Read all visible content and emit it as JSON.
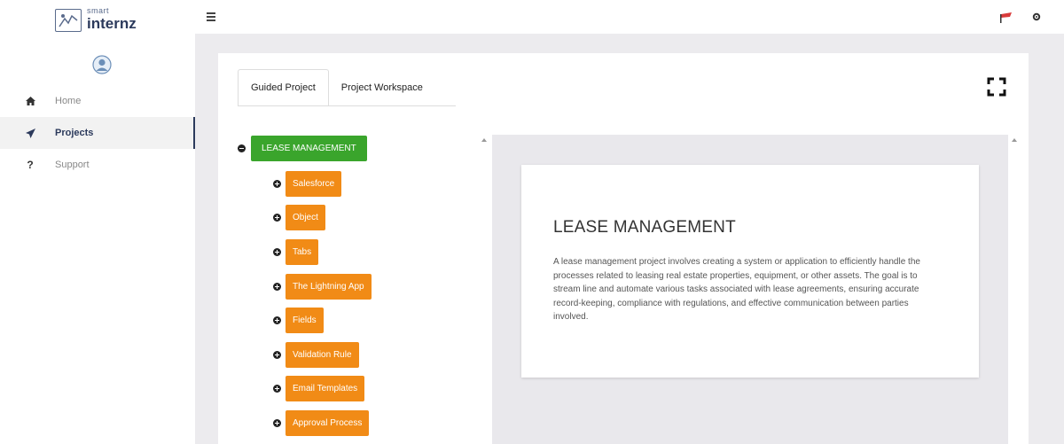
{
  "brand": {
    "line1": "smart",
    "line2": "internz"
  },
  "sidebar": {
    "items": [
      {
        "label": "Home",
        "icon": "home-icon",
        "active": false
      },
      {
        "label": "Projects",
        "icon": "paper-plane-icon",
        "active": true
      },
      {
        "label": "Support",
        "icon": "question-icon",
        "active": false
      }
    ]
  },
  "header": {
    "menu_icon": "hamburger-icon",
    "flag_icon": "flag-icon",
    "settings_icon": "gear-icon"
  },
  "tabs": [
    {
      "label": "Guided Project",
      "active": true
    },
    {
      "label": "Project Workspace",
      "active": false
    }
  ],
  "tree": {
    "root": "LEASE MANAGEMENT",
    "children": [
      "Salesforce",
      "Object",
      "Tabs",
      "The Lightning App",
      "Fields",
      "Validation Rule",
      "Email Templates",
      "Approval Process"
    ]
  },
  "detail": {
    "title": "LEASE MANAGEMENT",
    "description": "A lease management project involves creating a system or application to efficiently handle the processes related to leasing real estate properties, equipment, or other assets. The goal is to stream line and automate various tasks associated with lease agreements, ensuring accurate record-keeping, compliance with regulations, and effective communication between parties involved."
  },
  "colors": {
    "root_node": "#3aa52c",
    "child_node": "#f18b16",
    "brand": "#2c3a5c",
    "panel_bg": "#e9e8ec"
  }
}
